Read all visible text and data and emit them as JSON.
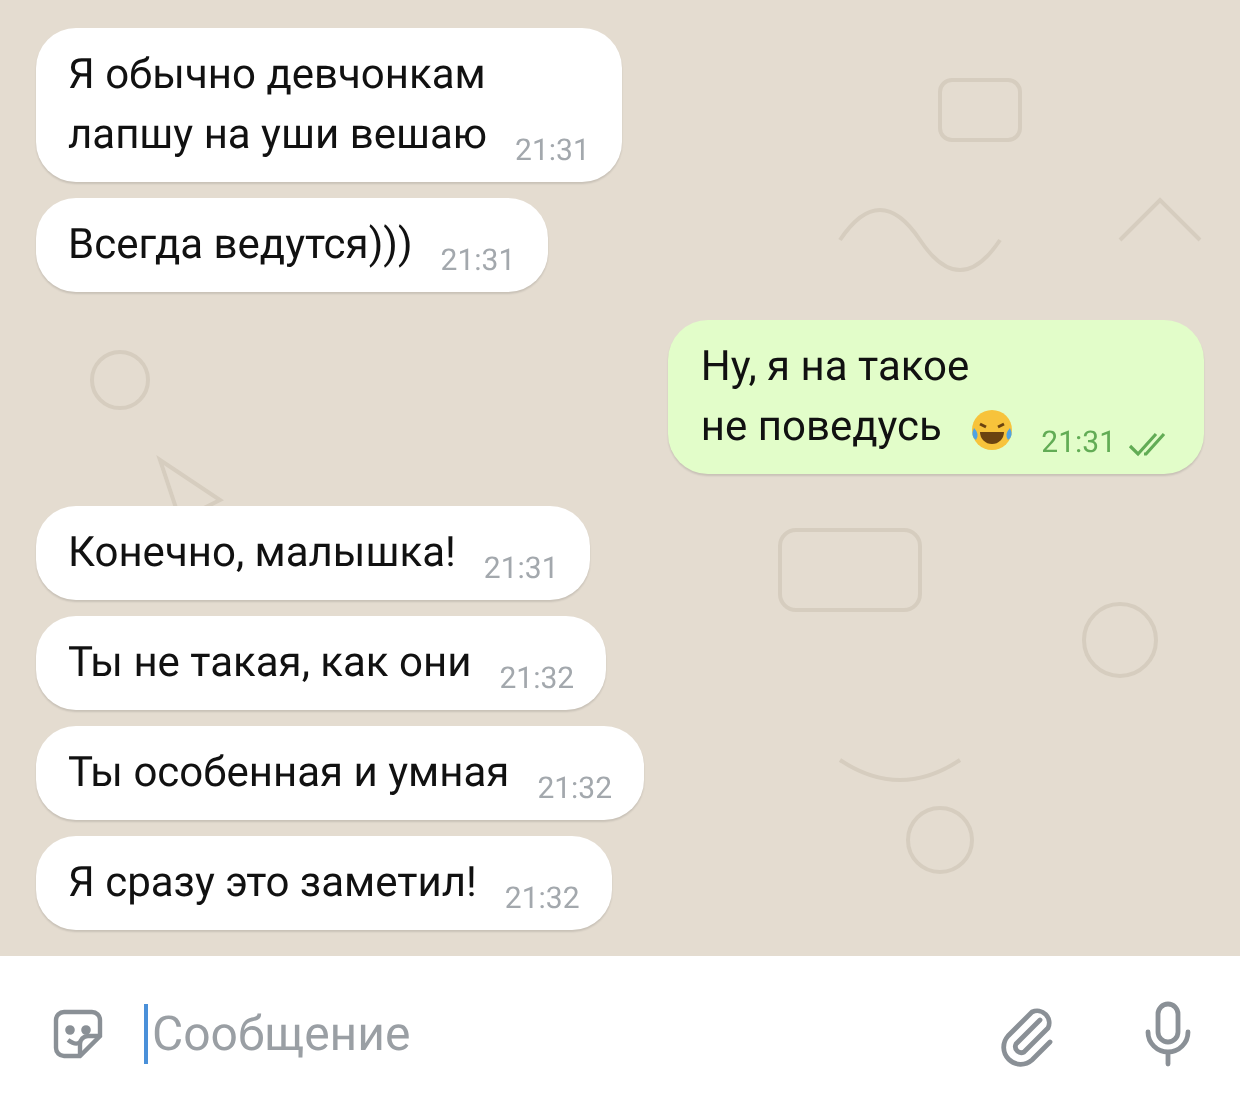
{
  "messages": [
    {
      "kind": "incoming",
      "text": "Я обычно девчонкам\nлапшу на уши вешаю",
      "time": "21:31"
    },
    {
      "kind": "incoming",
      "text": "Всегда ведутся)))",
      "time": "21:31"
    },
    {
      "kind": "outgoing",
      "text": "Ну, я на такое\nне поведусь",
      "emoji": true,
      "time": "21:31",
      "read": true
    },
    {
      "kind": "incoming",
      "text": "Конечно, малышка!",
      "time": "21:31"
    },
    {
      "kind": "incoming",
      "text": "Ты не такая, как они",
      "time": "21:32"
    },
    {
      "kind": "incoming",
      "text": "Ты особенная и умная",
      "time": "21:32"
    },
    {
      "kind": "incoming",
      "text": "Я сразу это заметил!",
      "time": "21:32"
    }
  ],
  "composer": {
    "placeholder": "Сообщение"
  }
}
